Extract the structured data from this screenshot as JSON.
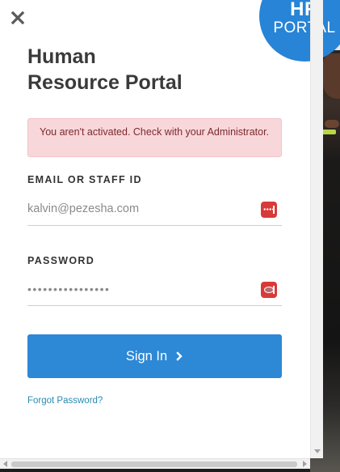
{
  "badge": {
    "line1": "HR",
    "line2": "PORTAL"
  },
  "header": {
    "title_line1": "Human",
    "title_line2": "Resource Portal"
  },
  "alert": {
    "message": "You aren't activated. Check with your Administrator."
  },
  "form": {
    "email": {
      "label": "EMAIL OR STAFF ID",
      "value": "kalvin@pezesha.com"
    },
    "password": {
      "label": "PASSWORD",
      "value": "••••••••••••••••"
    },
    "submit_label": "Sign In",
    "forgot_label": "Forgot Password?"
  },
  "icons": {
    "close": "close-icon",
    "password_manager": "password-manager-icon",
    "submit_chevron": "chevron-right-icon"
  },
  "colors": {
    "accent": "#2d88d6",
    "badge": "#2784d6",
    "alert_bg": "#f8d7da",
    "alert_text": "#7c2a2f",
    "link": "#2a8bb0",
    "pw_manager": "#d83a3a"
  }
}
